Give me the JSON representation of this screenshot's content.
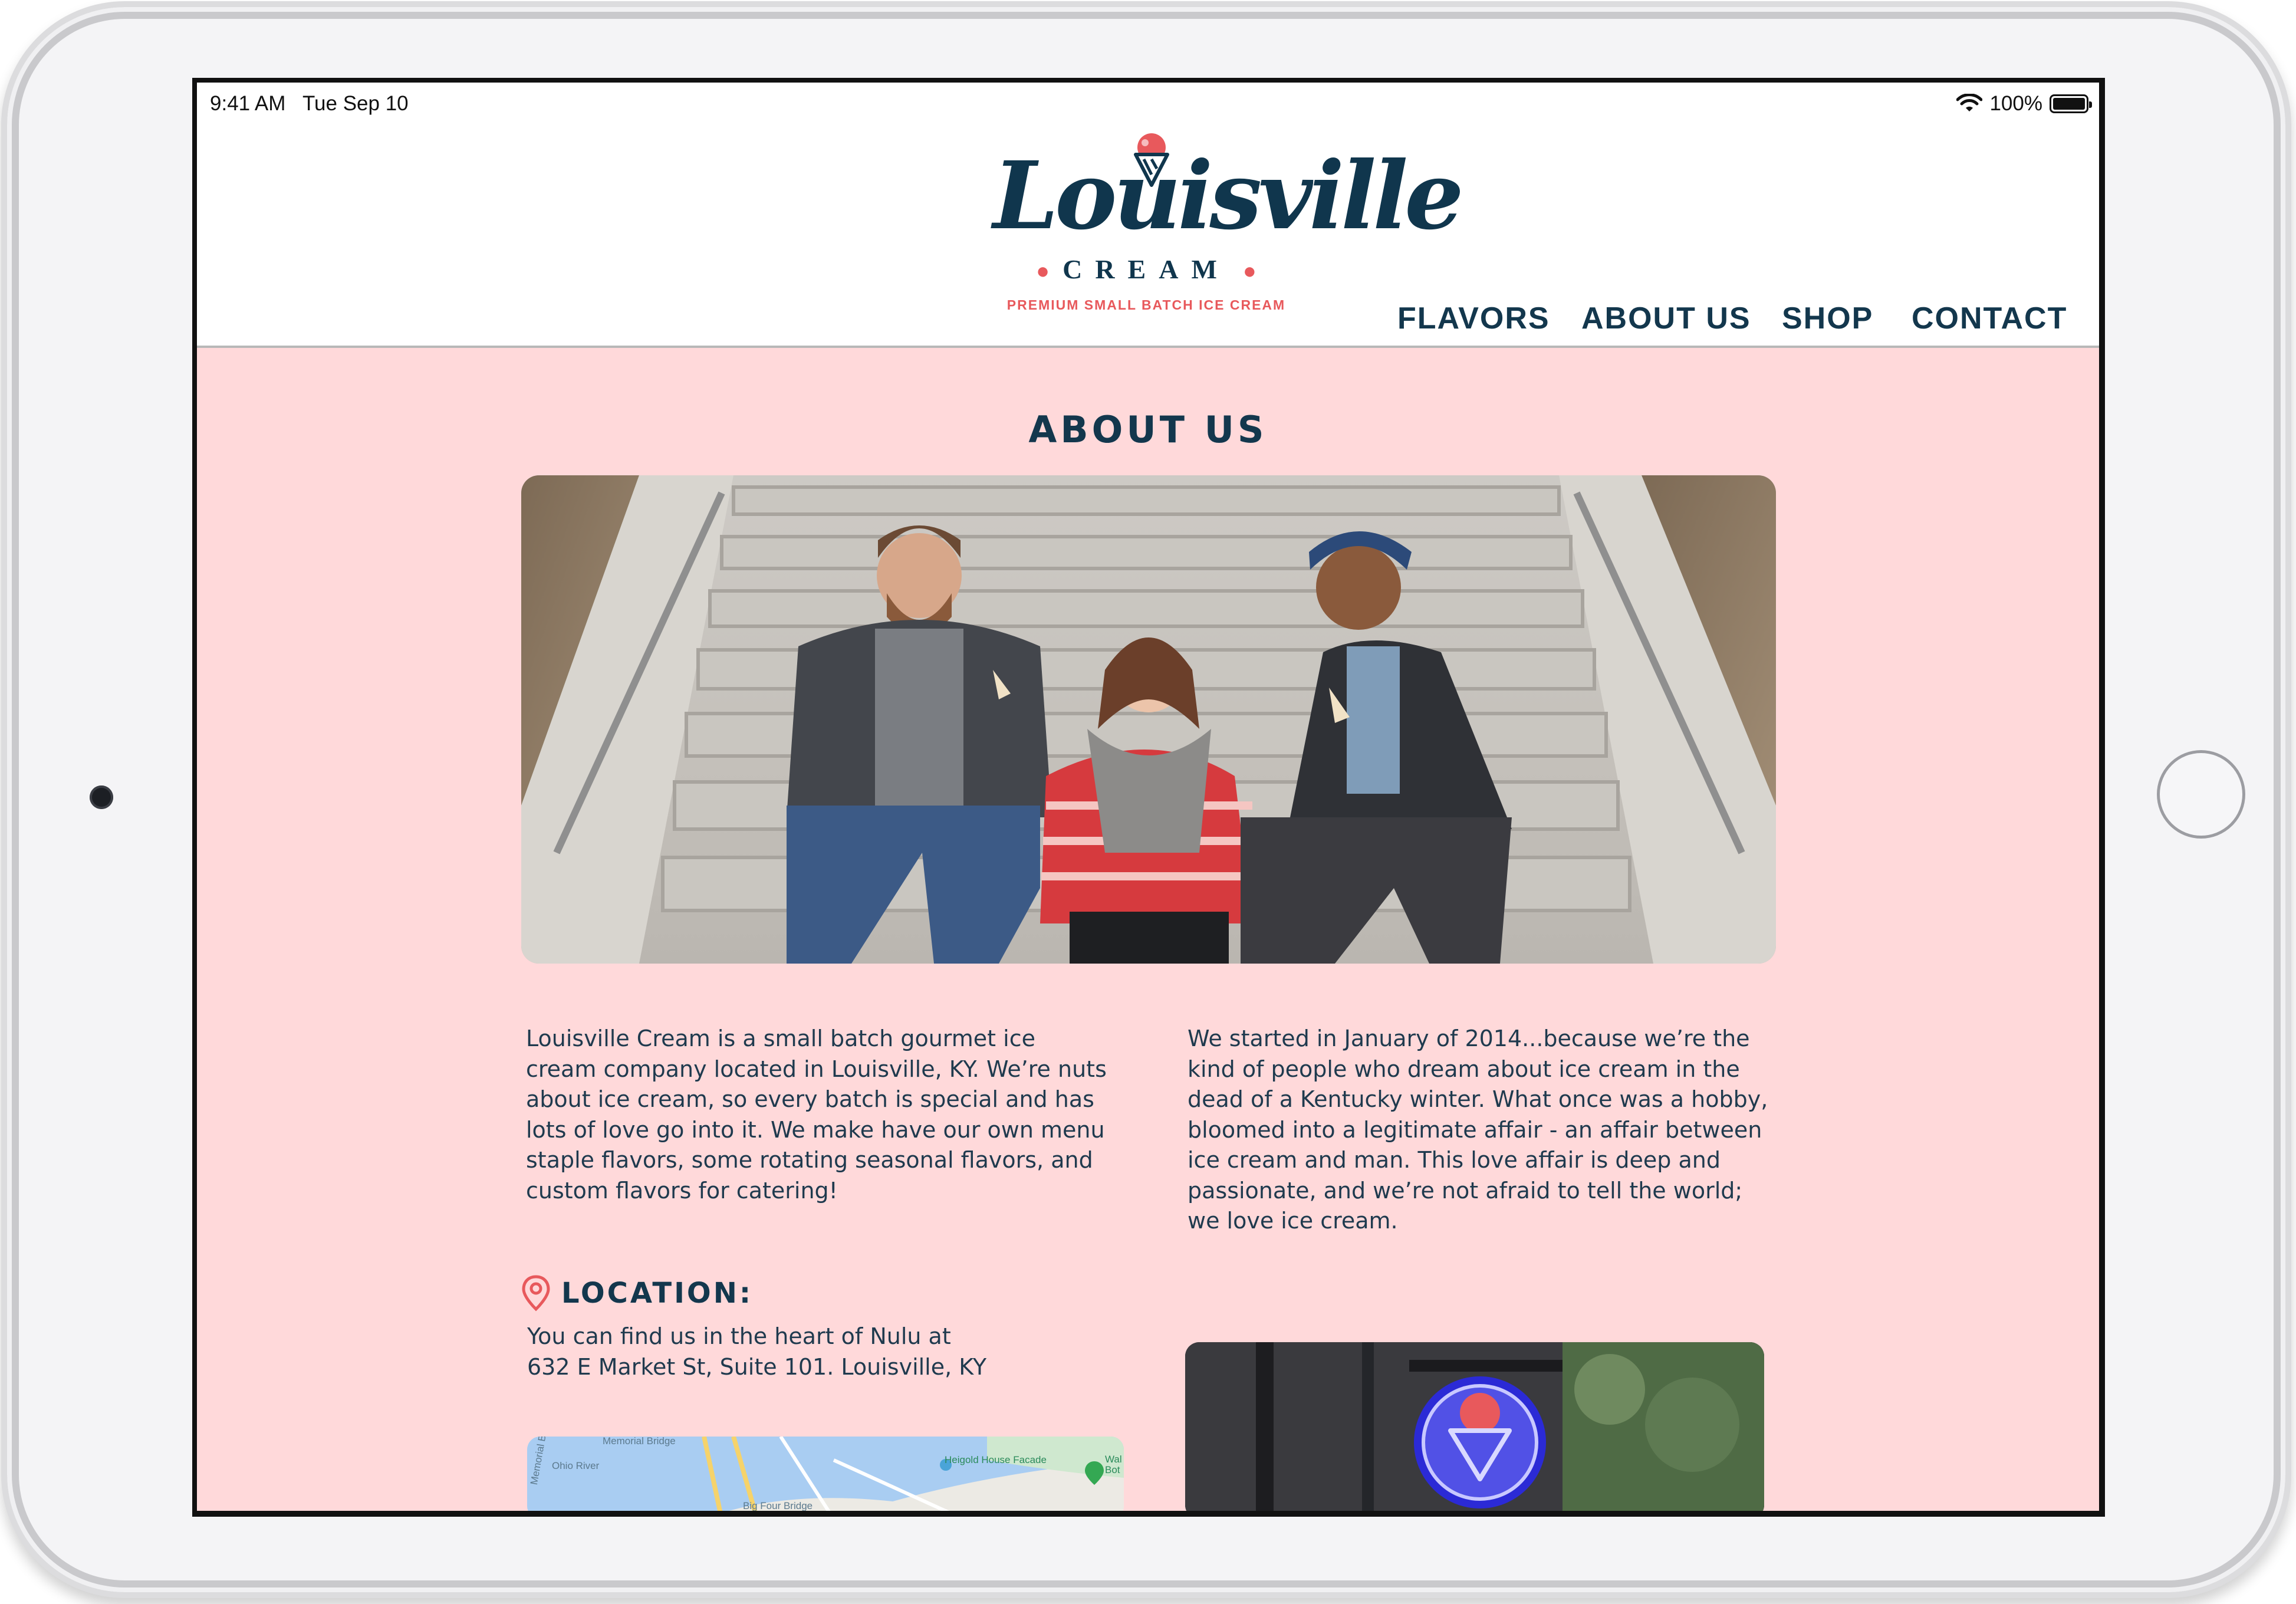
{
  "status_bar": {
    "time": "9:41 AM",
    "date": "Tue Sep 10",
    "battery": "100%"
  },
  "logo": {
    "name": "Louisville",
    "subname": "CREAM",
    "tagline": "PREMIUM SMALL BATCH ICE CREAM"
  },
  "nav": {
    "items": [
      {
        "label": "FLAVORS"
      },
      {
        "label": "ABOUT US"
      },
      {
        "label": "SHOP"
      },
      {
        "label": "CONTACT"
      }
    ]
  },
  "page": {
    "title": "ABOUT US",
    "intro_left": "Louisville Cream is a small batch gourmet ice cream company located in Louisville, KY.  We’re nuts about ice cream, so every batch is special and has lots of love go into it.  We make have our own menu staple flavors, some rotating seasonal flavors, and custom flavors for catering!",
    "intro_right": "We started in January of 2014...because we’re the kind of people who dream about ice cream in the dead of a Kentucky winter. What once was a hobby, bloomed into a legitimate affair - an affair between ice cream and man.  This love affair is deep and passionate, and we’re not afraid to tell the world; we love ice cream."
  },
  "location": {
    "label": "LOCATION:",
    "line1": "You can find us in the heart of Nulu at",
    "line2": "632 E Market St, Suite 101. Louisville, KY"
  },
  "map": {
    "labels": {
      "river": "Ohio River",
      "bridge_top": "Memorial Bridge",
      "bridge_side": "Memorial Bridge",
      "place": "Heigold House Facade",
      "bridge_bottom": "Big Four Bridge",
      "cut_place": "Wal Bot"
    }
  },
  "colors": {
    "brand_navy": "#13374d",
    "brand_coral": "#e8595c",
    "page_pink": "#ffd9da"
  },
  "icons": {
    "location": "map-pin-icon",
    "wifi": "wifi-icon",
    "battery": "battery-icon",
    "cone": "ice-cream-cone-icon"
  }
}
